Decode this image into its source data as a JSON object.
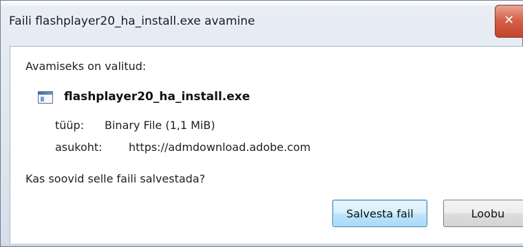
{
  "window": {
    "title": "Faili flashplayer20_ha_install.exe avamine",
    "close_icon": "close-icon",
    "close_glyph": "✕"
  },
  "dialog": {
    "intro": "Avamiseks on valitud:",
    "file_icon": "file-icon",
    "file_name": "flashplayer20_ha_install.exe",
    "type_label": "tüüp:",
    "type_value": "Binary File (1,1 MiB)",
    "location_label": "asukoht:",
    "location_value": "https://admdownload.adobe.com",
    "question": "Kas soovid selle faili salvestada?"
  },
  "buttons": {
    "save_label": "Salvesta fail",
    "cancel_label": "Loobu"
  },
  "colors": {
    "close_button": "#c9543a",
    "primary_button_border": "#3c7fb1"
  }
}
